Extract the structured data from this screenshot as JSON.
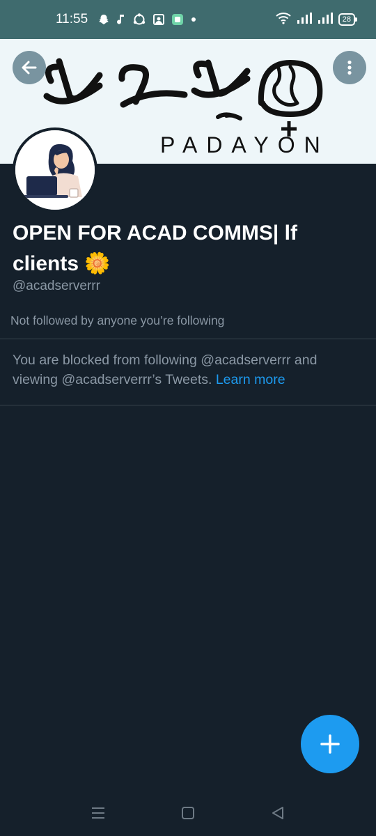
{
  "status_bar": {
    "time": "11:55",
    "battery": "28",
    "icons": [
      "snapchat-icon",
      "music-note-icon",
      "sync-icon",
      "gallery-icon",
      "app-icon",
      "dot-icon",
      "wifi-icon",
      "signal-icon",
      "signal-icon-2",
      "battery-icon"
    ]
  },
  "banner": {
    "text": "PADAYON",
    "script_note_icon": "baybayin-script"
  },
  "profile": {
    "name": "OPEN FOR ACAD COMMS| lf clients",
    "name_emoji": "🌼",
    "handle": "@acadserverrr",
    "followed_by": "Not followed by anyone you’re following",
    "blocked_text": "You are blocked from following @acadserverrr and viewing @acadserverrr’s Tweets.",
    "learn_more": "Learn more"
  },
  "colors": {
    "background": "#15202b",
    "status_bar": "#3f6b6e",
    "accent": "#1d9bf0",
    "muted": "#8b98a5"
  }
}
